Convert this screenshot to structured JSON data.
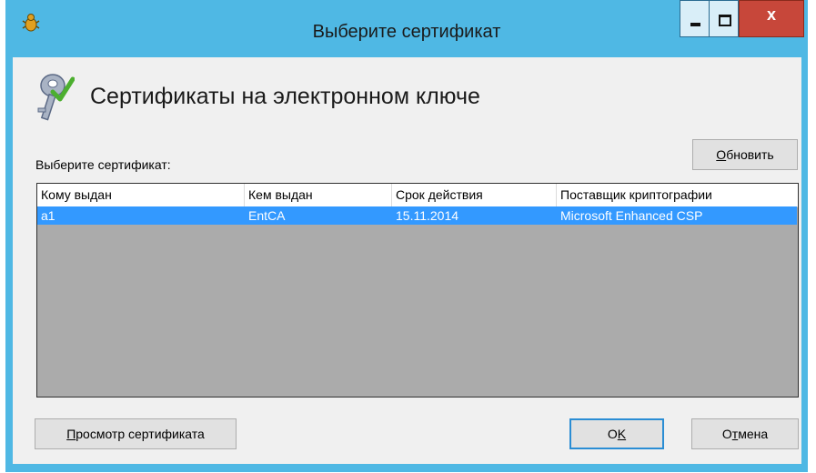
{
  "window": {
    "title": "Выберите сертификат",
    "close_glyph": "x"
  },
  "header": {
    "title": "Сертификаты на электронном ключе"
  },
  "list": {
    "label": "Выберите сертификат:",
    "columns": [
      "Кому выдан",
      "Кем выдан",
      "Срок действия",
      "Поставщик криптографии"
    ],
    "rows": [
      {
        "issued_to": "a1",
        "issued_by": "EntCA",
        "valid_until": "15.11.2014",
        "provider": "Microsoft Enhanced CSP",
        "selected": true
      }
    ]
  },
  "buttons": {
    "refresh": {
      "underlined": "О",
      "rest": "бновить"
    },
    "view": {
      "underlined": "П",
      "rest": "росмотр сертификата"
    },
    "ok": {
      "prefix": "O",
      "underlined": "K"
    },
    "cancel": {
      "prefix": "О",
      "underlined": "т",
      "rest": "мена"
    }
  },
  "colors": {
    "frame": "#4fb8e4",
    "selection": "#3399ff",
    "list_background": "#ababab",
    "close_button": "#c7473a"
  },
  "icons": [
    "app-icon",
    "keys-icon",
    "minimize-icon",
    "maximize-icon",
    "close-icon"
  ]
}
